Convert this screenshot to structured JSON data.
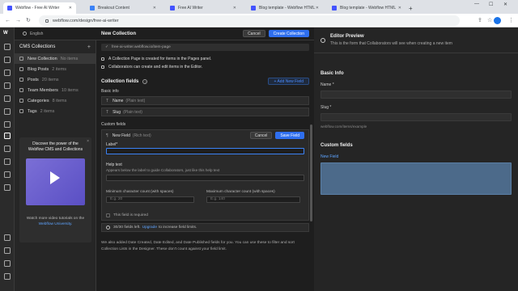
{
  "browser": {
    "tabs": [
      {
        "label": "Webflow - Free AI Writer",
        "active": true
      },
      {
        "label": "Breakout Content",
        "active": false
      },
      {
        "label": "Free AI Writer",
        "active": false
      },
      {
        "label": "Blog template - Webflow HTML",
        "active": false
      },
      {
        "label": "Blog template - Webflow HTML",
        "active": false
      }
    ],
    "new_tab": "+",
    "url": "webflow.com/design/free-ai-writer"
  },
  "topbar": {
    "locale": "English"
  },
  "sidebar": {
    "title": "CMS Collections",
    "add": "+",
    "items": [
      {
        "label": "New Collection",
        "count": "No items"
      },
      {
        "label": "Blog Posts",
        "count": "2 items"
      },
      {
        "label": "Posts",
        "count": "20 items"
      },
      {
        "label": "Team Members",
        "count": "10 items"
      },
      {
        "label": "Categories",
        "count": "8 items"
      },
      {
        "label": "Tags",
        "count": "2 items"
      }
    ],
    "promo": {
      "close": "×",
      "title": "Discover the power of the Webflow CMS and Collections",
      "footer": "Watch more video tutorials on the",
      "link": "Webflow University."
    }
  },
  "main": {
    "title": "New Collection",
    "cancel": "Cancel",
    "create": "Create Collection",
    "path": "free-ai-writer.webflow.io/item-page",
    "info1": "A Collection Page is created for items in the Pages panel.",
    "info2": "Collaborators can create and edit items in the Editor.",
    "fields_title": "Collection fields",
    "add_field": "+ Add New Field",
    "basic_info": "Basic info",
    "name_field": {
      "label": "Name",
      "type": "(Plain text)"
    },
    "slug_field": {
      "label": "Slug",
      "type": "(Plain text)"
    },
    "custom_fields": "Custom fields",
    "new_field": {
      "label": "New Field",
      "type": "(Rich text)",
      "cancel": "Cancel",
      "save": "Save Field",
      "label_title": "Label*",
      "help_title": "Help text",
      "help_desc": "Appears below the label to guide Collaborators, just like this help text",
      "min_label": "Minimum character count (with spaces)",
      "min_ph": "E.g. 20",
      "max_label": "Maximum character count (with spaces)",
      "max_ph": "E.g. 140",
      "required": "This field is required"
    },
    "tip": {
      "text": "30/30 fields left.",
      "link": "Upgrade",
      "rest": "to increase field limits."
    },
    "note": "We also added Date Created, Date Edited, and Date Published fields for you. You can use these to filter and sort Collection Lists in the Designer. These don't count against your field limit."
  },
  "preview": {
    "title": "Editor Preview",
    "subtitle": "This is the form that Collaborators will see when creating a new item",
    "basic_info": "Basic Info",
    "name_label": "Name *",
    "slug_label": "Slug *",
    "slug_hint": "webflow.com/items/example",
    "custom_fields": "Custom fields",
    "new_field": "New Field"
  }
}
